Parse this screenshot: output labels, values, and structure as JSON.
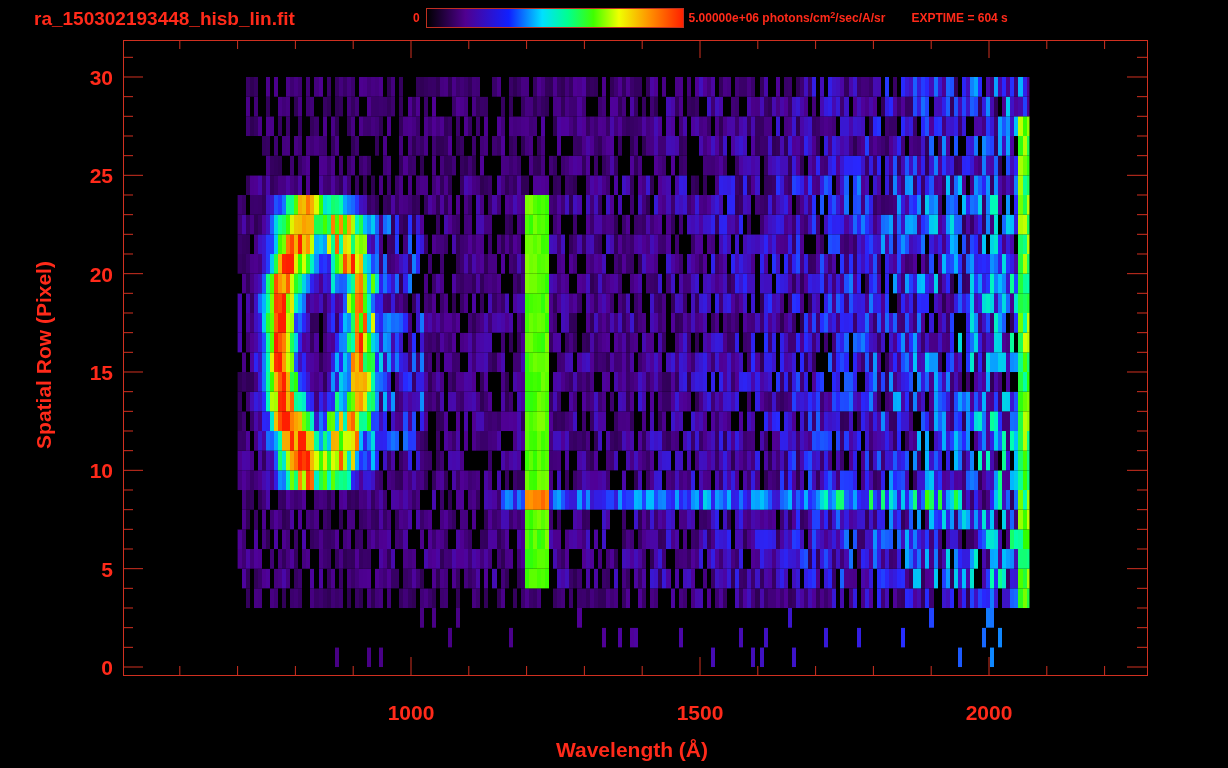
{
  "header": {
    "filename": "ra_150302193448_hisb_lin.fit",
    "colorbar": {
      "min_label": "0",
      "max_label": "5.00000e+06 photons/cm$^{2}$/sec/A/sr"
    },
    "exposure": "EXPTIME = 604 s"
  },
  "plot": {
    "ylabel": "Spatial Row (Pixel)",
    "xlabel": "Wavelength (Å)",
    "yticks": [
      "30",
      "25",
      "20",
      "15",
      "10",
      "5",
      "0"
    ],
    "xticks": [
      "1000",
      "1500",
      "2000"
    ]
  }
}
